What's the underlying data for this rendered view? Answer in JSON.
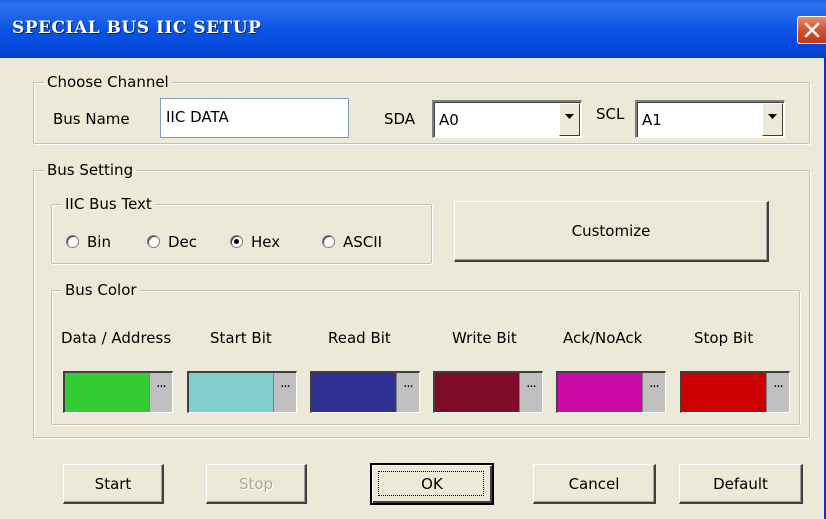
{
  "window": {
    "title": "SPECIAL BUS IIC SETUP"
  },
  "channel": {
    "legend": "Choose Channel",
    "bus_name_label": "Bus Name",
    "bus_name_value": "IIC DATA",
    "sda_label": "SDA",
    "sda_value": "A0",
    "scl_label": "SCL",
    "scl_value": "A1"
  },
  "bus_setting": {
    "legend": "Bus Setting",
    "text_group": {
      "legend": "IIC Bus Text",
      "options": [
        {
          "label": "Bin",
          "selected": false
        },
        {
          "label": "Dec",
          "selected": false
        },
        {
          "label": "Hex",
          "selected": true
        },
        {
          "label": "ASCII",
          "selected": false
        }
      ]
    },
    "customize_label": "Customize",
    "color_group": {
      "legend": "Bus Color",
      "more_label": "...",
      "items": [
        {
          "label": "Data / Address",
          "color": "#33cc33"
        },
        {
          "label": "Start Bit",
          "color": "#7fcfcf"
        },
        {
          "label": "Read Bit",
          "color": "#2e3192"
        },
        {
          "label": "Write Bit",
          "color": "#7f0a2a"
        },
        {
          "label": "Ack/NoAck",
          "color": "#cc0aa6"
        },
        {
          "label": "Stop Bit",
          "color": "#cc0000"
        }
      ]
    }
  },
  "buttons": {
    "start": "Start",
    "stop": "Stop",
    "ok": "OK",
    "cancel": "Cancel",
    "default": "Default"
  }
}
